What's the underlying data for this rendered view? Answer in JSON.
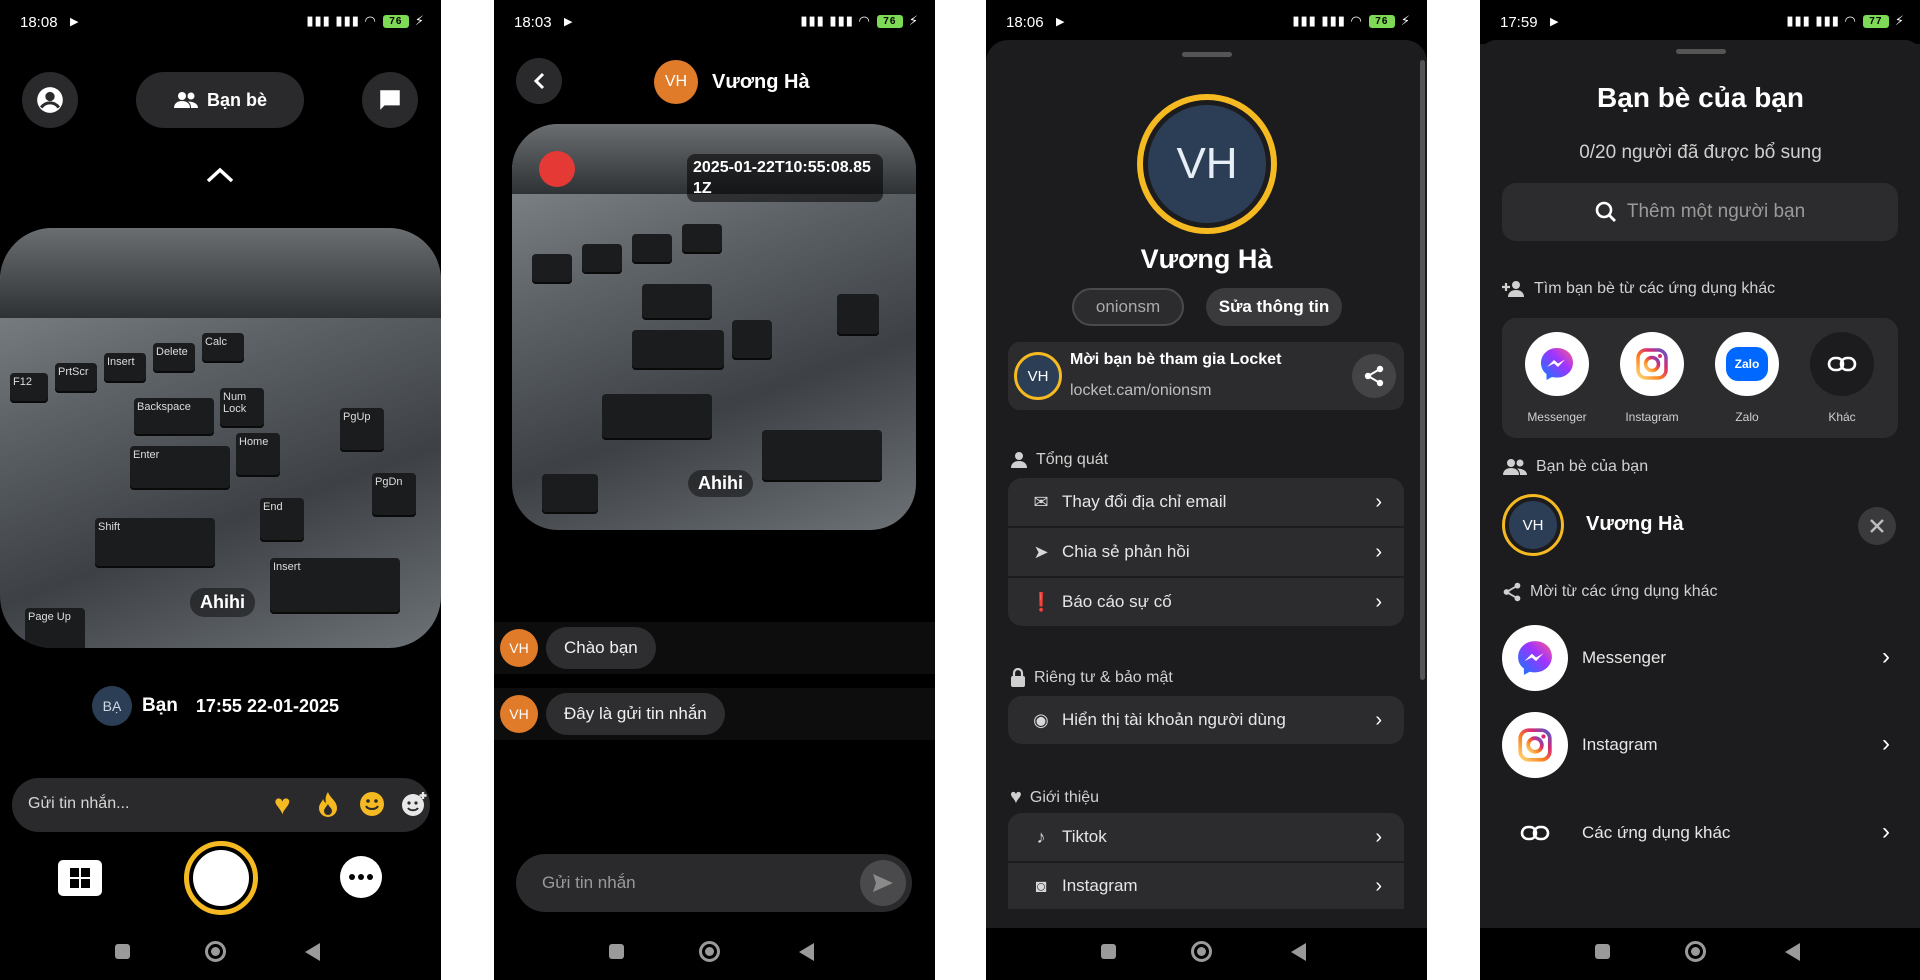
{
  "screen1": {
    "status": {
      "time": "18:08",
      "battery": "76"
    },
    "friends_button": "Bạn bè",
    "photo_caption": "Ahihi",
    "keys": [
      "F12",
      "PrtScr",
      "Insert",
      "Delete",
      "Calc",
      "Backspace",
      "Num Lock",
      "Enter",
      "Home",
      "PgUp",
      "End",
      "PgDn",
      "Shift",
      "Insert",
      "Page Up"
    ],
    "author_initials": "BẠ",
    "author_name": "Bạn",
    "timestamp": "17:55 22-01-2025",
    "message_placeholder": "Gửi tin nhắn..."
  },
  "screen2": {
    "status": {
      "time": "18:03",
      "battery": "76"
    },
    "contact_initials": "VH",
    "contact_name": "Vương Hà",
    "photo_timestamp": "2025-01-22T10:55:08.851Z",
    "photo_caption": "Ahihi",
    "messages": [
      {
        "initials": "VH",
        "text": "Chào bạn"
      },
      {
        "initials": "VH",
        "text": "Đây là gửi tin nhắn"
      }
    ],
    "input_placeholder": "Gửi tin nhắn"
  },
  "screen3": {
    "status": {
      "time": "18:06",
      "battery": "76"
    },
    "avatar_initials": "VH",
    "name": "Vương Hà",
    "username": "onionsm",
    "edit_button": "Sửa thông tin",
    "invite": {
      "initials": "VH",
      "title": "Mời bạn bè tham gia Locket",
      "link": "locket.cam/onionsm"
    },
    "sections": {
      "general": {
        "label": "Tổng quát",
        "items": [
          "Thay đổi địa chỉ email",
          "Chia sẻ phản hồi",
          "Báo cáo sự cố"
        ]
      },
      "privacy": {
        "label": "Riêng tư & bảo mật",
        "items": [
          "Hiển thị tài khoản người dùng"
        ]
      },
      "about": {
        "label": "Giới thiệu",
        "items": [
          "Tiktok",
          "Instagram"
        ]
      }
    }
  },
  "screen4": {
    "status": {
      "time": "17:59",
      "battery": "77"
    },
    "title": "Bạn bè của bạn",
    "subtitle": "0/20 người đã được bổ sung",
    "search_placeholder": "Thêm một người bạn",
    "find_label": "Tìm bạn bè từ các ứng dụng khác",
    "apps": [
      {
        "name": "Messenger",
        "icon": "messenger-icon"
      },
      {
        "name": "Instagram",
        "icon": "instagram-icon"
      },
      {
        "name": "Zalo",
        "icon": "zalo-icon"
      },
      {
        "name": "Khác",
        "icon": "link-icon"
      }
    ],
    "zalo_logo": "Zalo",
    "friends_label": "Bạn bè của bạn",
    "friend": {
      "initials": "VH",
      "name": "Vương Hà"
    },
    "invite_label": "Mời từ các ứng dụng khác",
    "invite_items": [
      "Messenger",
      "Instagram",
      "Các ứng dụng khác"
    ]
  },
  "colors": {
    "accent_yellow": "#f5b921",
    "avatar_orange": "#e07b2a",
    "avatar_navy": "#2c3e55"
  }
}
